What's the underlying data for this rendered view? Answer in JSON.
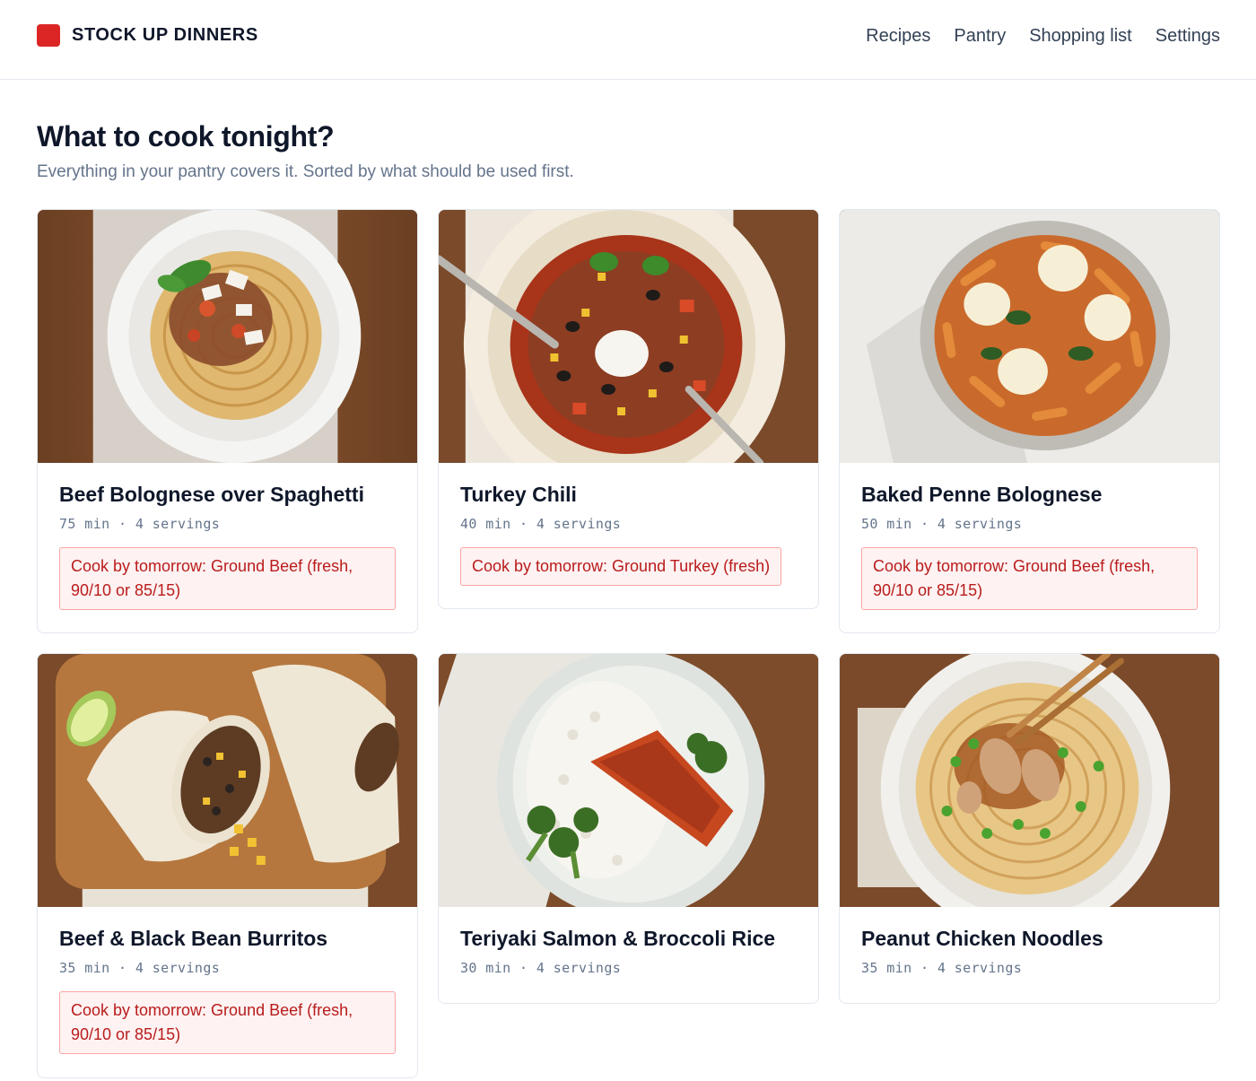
{
  "header": {
    "brand": "STOCK UP DINNERS",
    "nav": [
      "Recipes",
      "Pantry",
      "Shopping list",
      "Settings"
    ]
  },
  "page": {
    "title": "What to cook tonight?",
    "subtitle": "Everything in your pantry covers it. Sorted by what should be used first."
  },
  "recipes": [
    {
      "title": "Beef Bolognese over Spaghetti",
      "meta": "75 min · 4 servings",
      "alert": "Cook by tomorrow: Ground Beef (fresh, 90/10 or 85/15)",
      "image_icon": "spaghetti-bolognese-photo"
    },
    {
      "title": "Turkey Chili",
      "meta": "40 min · 4 servings",
      "alert": "Cook by tomorrow: Ground Turkey (fresh)",
      "image_icon": "turkey-chili-photo"
    },
    {
      "title": "Baked Penne Bolognese",
      "meta": "50 min · 4 servings",
      "alert": "Cook by tomorrow: Ground Beef (fresh, 90/10 or 85/15)",
      "image_icon": "baked-penne-photo"
    },
    {
      "title": "Beef & Black Bean Burritos",
      "meta": "35 min · 4 servings",
      "alert": "Cook by tomorrow: Ground Beef (fresh, 90/10 or 85/15)",
      "image_icon": "burritos-photo"
    },
    {
      "title": "Teriyaki Salmon & Broccoli Rice",
      "meta": "30 min · 4 servings",
      "image_icon": "teriyaki-salmon-photo"
    },
    {
      "title": "Peanut Chicken Noodles",
      "meta": "35 min · 4 servings",
      "image_icon": "peanut-noodles-photo"
    }
  ],
  "colors": {
    "brand": "#dc2626",
    "alert_text": "#b91c1c",
    "alert_bg": "#fef2f2",
    "alert_border": "#fca5a5"
  }
}
